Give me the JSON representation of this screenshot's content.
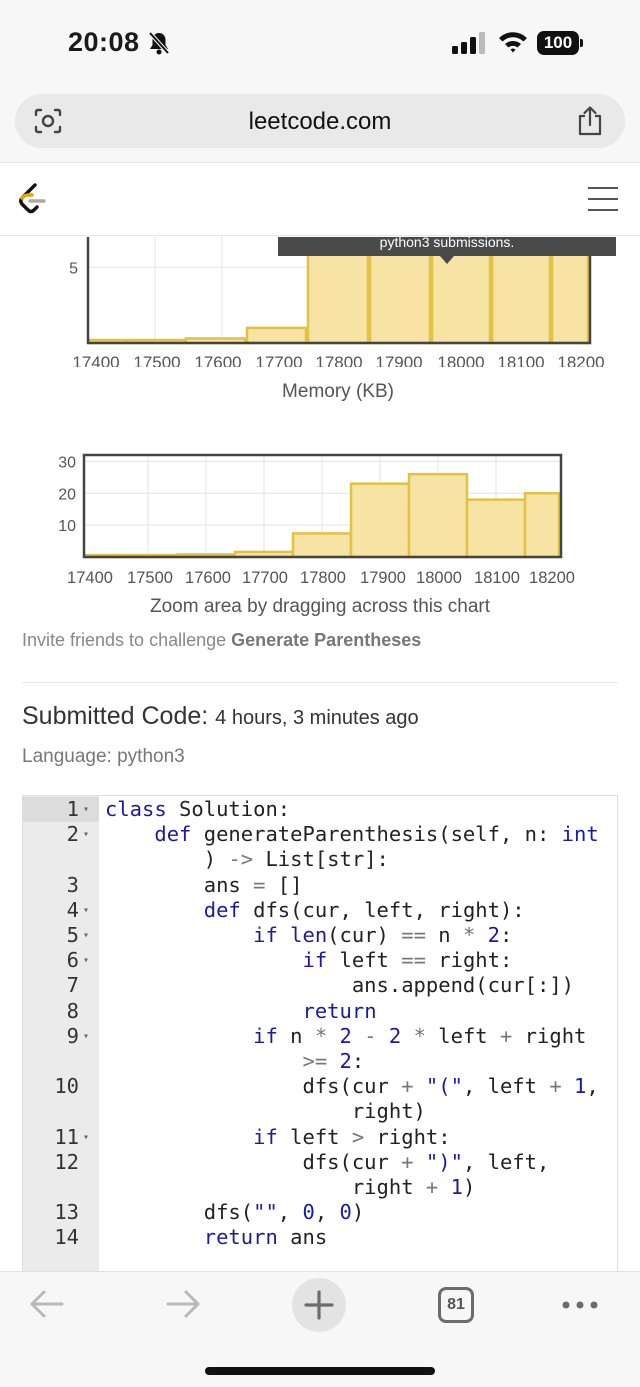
{
  "status_bar": {
    "time": "20:08",
    "battery": "100"
  },
  "browser": {
    "url": "leetcode.com",
    "tab_count": "81"
  },
  "chart_memory": {
    "tooltip_text": "python3 submissions.",
    "ytick": "5",
    "xticks": [
      "17400",
      "17500",
      "17600",
      "17700",
      "17800",
      "17900",
      "18000",
      "18100",
      "18200"
    ],
    "xlabel": "Memory (KB)"
  },
  "chart_overview": {
    "yticks": [
      "30",
      "20",
      "10"
    ],
    "xticks": [
      "17400",
      "17500",
      "17600",
      "17700",
      "17800",
      "17900",
      "18000",
      "18100",
      "18200"
    ],
    "zoom_hint": "Zoom area by dragging across this chart"
  },
  "chart_data": [
    {
      "type": "bar",
      "categories": [
        "17400",
        "17500",
        "17600",
        "17700",
        "17800",
        "17900",
        "18000",
        "18100",
        "18200"
      ],
      "values": [
        0.2,
        0.2,
        0.3,
        1.0,
        6.8,
        6.8,
        6.8,
        6.8,
        6.8
      ],
      "xlabel": "Memory (KB)",
      "ylabel": "",
      "ylim": [
        0,
        7
      ],
      "grid": true
    },
    {
      "type": "bar",
      "categories": [
        "17400",
        "17500",
        "17600",
        "17700",
        "17800",
        "17900",
        "18000",
        "18100",
        "18200"
      ],
      "values": [
        0.6,
        0.6,
        0.8,
        1.6,
        7.4,
        23.0,
        26.0,
        18.0,
        20.0
      ],
      "xlabel": "",
      "ylabel": "",
      "ylim": [
        0,
        32
      ],
      "grid": true
    }
  ],
  "invite": {
    "prefix": "Invite friends to challenge ",
    "problem": "Generate Parentheses"
  },
  "submission": {
    "heading": "Submitted Code:",
    "time": "4 hours, 3 minutes ago",
    "language": "Language: python3"
  },
  "code_lines": [
    {
      "num": "1",
      "fold": true,
      "text": "class Solution:"
    },
    {
      "num": "2",
      "fold": true,
      "text": "    def generateParenthesis(self, n: int"
    },
    {
      "num": "",
      "fold": false,
      "text": "        ) -> List[str]:"
    },
    {
      "num": "3",
      "fold": false,
      "text": "        ans = []"
    },
    {
      "num": "4",
      "fold": true,
      "text": "        def dfs(cur, left, right):"
    },
    {
      "num": "5",
      "fold": true,
      "text": "            if len(cur) == n * 2:"
    },
    {
      "num": "6",
      "fold": true,
      "text": "                if left == right:"
    },
    {
      "num": "7",
      "fold": false,
      "text": "                    ans.append(cur[:])"
    },
    {
      "num": "8",
      "fold": false,
      "text": "                return"
    },
    {
      "num": "9",
      "fold": true,
      "text": "            if n * 2 - 2 * left + right"
    },
    {
      "num": "",
      "fold": false,
      "text": "                >= 2:"
    },
    {
      "num": "10",
      "fold": false,
      "text": "                dfs(cur + \"(\", left + 1,"
    },
    {
      "num": "",
      "fold": false,
      "text": "                    right)"
    },
    {
      "num": "11",
      "fold": true,
      "text": "            if left > right:"
    },
    {
      "num": "12",
      "fold": false,
      "text": "                dfs(cur + \")\", left,"
    },
    {
      "num": "",
      "fold": false,
      "text": "                    right + 1)"
    },
    {
      "num": "13",
      "fold": false,
      "text": "        dfs(\"\", 0, 0)"
    },
    {
      "num": "14",
      "fold": false,
      "text": "        return ans"
    }
  ],
  "colors": {
    "bar_fill": "#f7e3a3",
    "bar_stroke": "#e2c244",
    "keyword": "#1a1aa6",
    "tooltip_bg": "#4a4a4a"
  }
}
